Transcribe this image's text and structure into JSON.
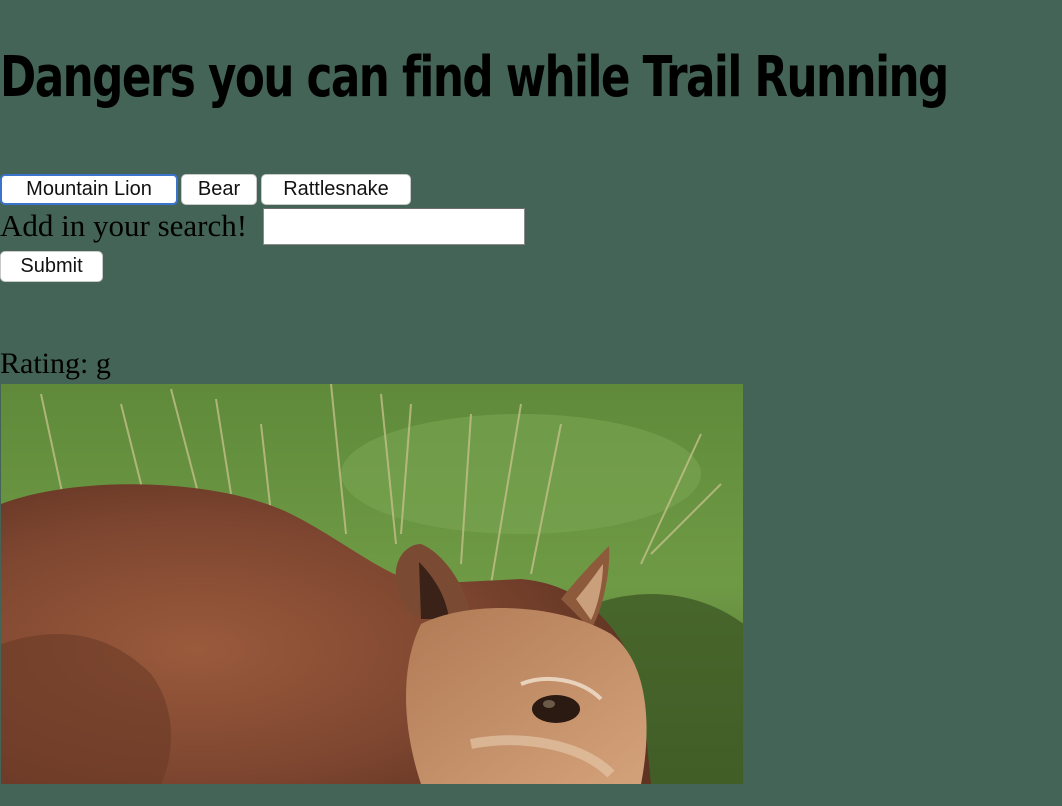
{
  "header": {
    "title": "Dangers you can find while Trail Running"
  },
  "topic_buttons": [
    {
      "label": "Mountain Lion",
      "focused": true
    },
    {
      "label": "Bear",
      "focused": false
    },
    {
      "label": "Rattlesnake",
      "focused": false
    }
  ],
  "search": {
    "label": "Add in your search!",
    "value": "",
    "placeholder": "",
    "submit_label": "Submit"
  },
  "result": {
    "rating_label": "Rating:",
    "rating_value": "g",
    "image_subject": "mountain lion"
  },
  "colors": {
    "page_background": "#436457",
    "focus_ring": "#3a74cc"
  }
}
